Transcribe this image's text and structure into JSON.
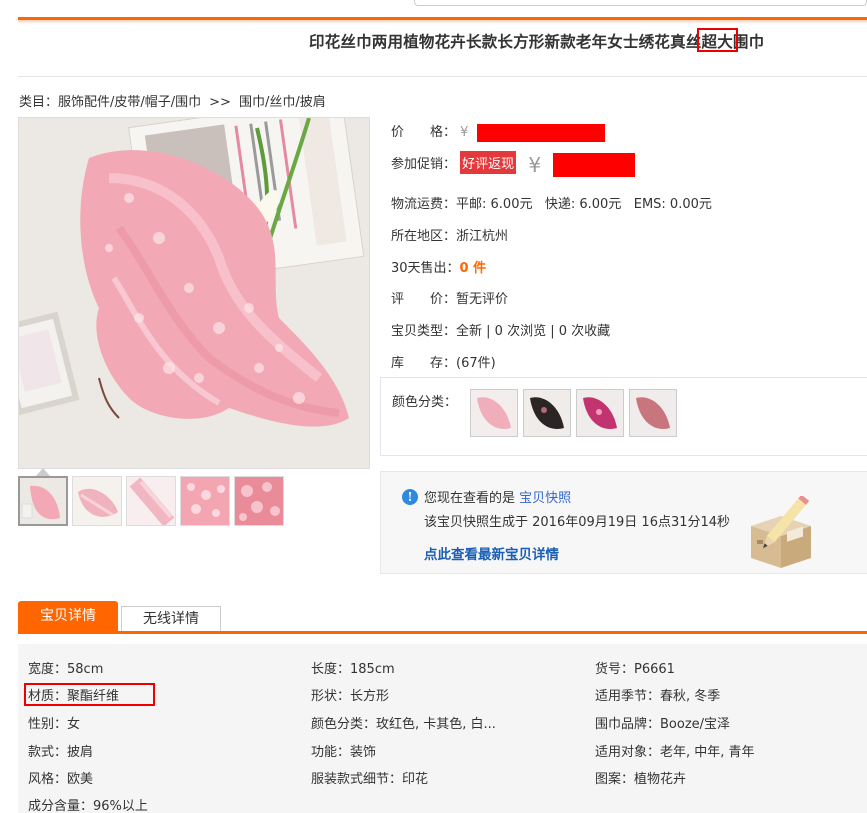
{
  "product": {
    "title": "印花丝巾两用植物花卉长款长方形新款老年女士绣花真丝超大围巾"
  },
  "breadcrumb": {
    "prefix": "类目：",
    "category": "服饰配件/皮带/帽子/围巾",
    "separator": ">>",
    "subcategory": "围巾/丝巾/披肩"
  },
  "info": {
    "price_label": "价　　格：",
    "price_symbol": "¥",
    "promo_label": "参加促销：",
    "promo_tag": "好评返现",
    "promo_symbol": "¥",
    "shipping_label": "物流运费：",
    "shipping_value": "平邮: 6.00元   快递: 6.00元   EMS: 0.00元",
    "location_label": "所在地区：",
    "location_value": "浙江杭州",
    "sold_label": "30天售出：",
    "sold_value": "0 件",
    "rating_label": "评　　价：",
    "rating_value": "暂无评价",
    "type_label": "宝贝类型：",
    "type_value": "全新 | 0 次浏览 | 0 次收藏",
    "stock_label": "库　　存：",
    "stock_value": "(67件)",
    "color_label": "颜色分类："
  },
  "swatches": [
    "pink",
    "black",
    "magenta",
    "rose"
  ],
  "snapshot": {
    "viewing_text": "您现在查看的是 ",
    "viewing_link": "宝贝快照",
    "generated_text": "该宝贝快照生成于 2016年09月19日 16点31分14秒",
    "latest_link": "点此查看最新宝贝详情"
  },
  "tabs": {
    "details": "宝贝详情",
    "mobile": "无线详情"
  },
  "attributes": [
    {
      "label": "宽度：",
      "value": "58cm"
    },
    {
      "label": "长度：",
      "value": "185cm"
    },
    {
      "label": "货号：",
      "value": "P6661"
    },
    {
      "label": "材质：",
      "value": "聚酯纤维"
    },
    {
      "label": "形状：",
      "value": "长方形"
    },
    {
      "label": "适用季节：",
      "value": "春秋, 冬季"
    },
    {
      "label": "性别：",
      "value": "女"
    },
    {
      "label": "颜色分类：",
      "value": "玫红色, 卡其色, 白..."
    },
    {
      "label": "围巾品牌：",
      "value": "Booze/宝泽"
    },
    {
      "label": "款式：",
      "value": "披肩"
    },
    {
      "label": "功能：",
      "value": "装饰"
    },
    {
      "label": "适用对象：",
      "value": "老年, 中年, 青年"
    },
    {
      "label": "风格：",
      "value": "欧美"
    },
    {
      "label": "服装款式细节：",
      "value": "印花"
    },
    {
      "label": "图案：",
      "value": "植物花卉"
    },
    {
      "label": "成分含量：",
      "value": "96%以上"
    }
  ],
  "colors": {
    "accent": "#ff6600",
    "highlight_box": "#ee0000",
    "link": "#3366cc",
    "redaction": "#ff0000"
  }
}
